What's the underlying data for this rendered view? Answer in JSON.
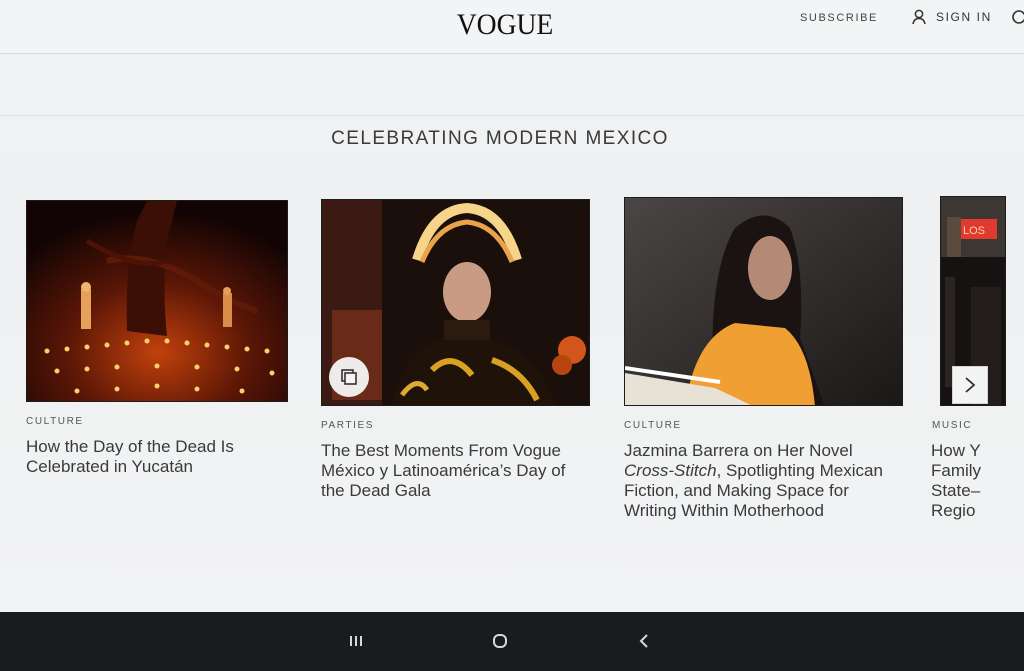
{
  "header": {
    "logo": "VOGUE",
    "subscribe_label": "SUBSCRIBE",
    "signin_label": "SIGN IN"
  },
  "section": {
    "title": "CELEBRATING MODERN MEXICO"
  },
  "cards": [
    {
      "category": "CULTURE",
      "title": "How the Day of the Dead Is Celebrated in Yucatán"
    },
    {
      "category": "PARTIES",
      "title": "The Best Moments From Vogue México y Latinoamérica’s Day of the Dead Gala"
    },
    {
      "category": "CULTURE",
      "title_before": "Jazmina Barrera on Her Novel ",
      "title_italic": "Cross-Stitch",
      "title_after": ", Spotlighting Mexican Fiction, and Making Space for Writing Within Motherhood"
    },
    {
      "category": "MUSIC",
      "title_lines": [
        "How Y",
        "Family",
        "State–",
        "Regio"
      ],
      "sign_text": "LOS"
    }
  ],
  "colors": {
    "background": "#eef0f1",
    "navbar": "#1a1b1d",
    "text": "#3a3a3a"
  }
}
